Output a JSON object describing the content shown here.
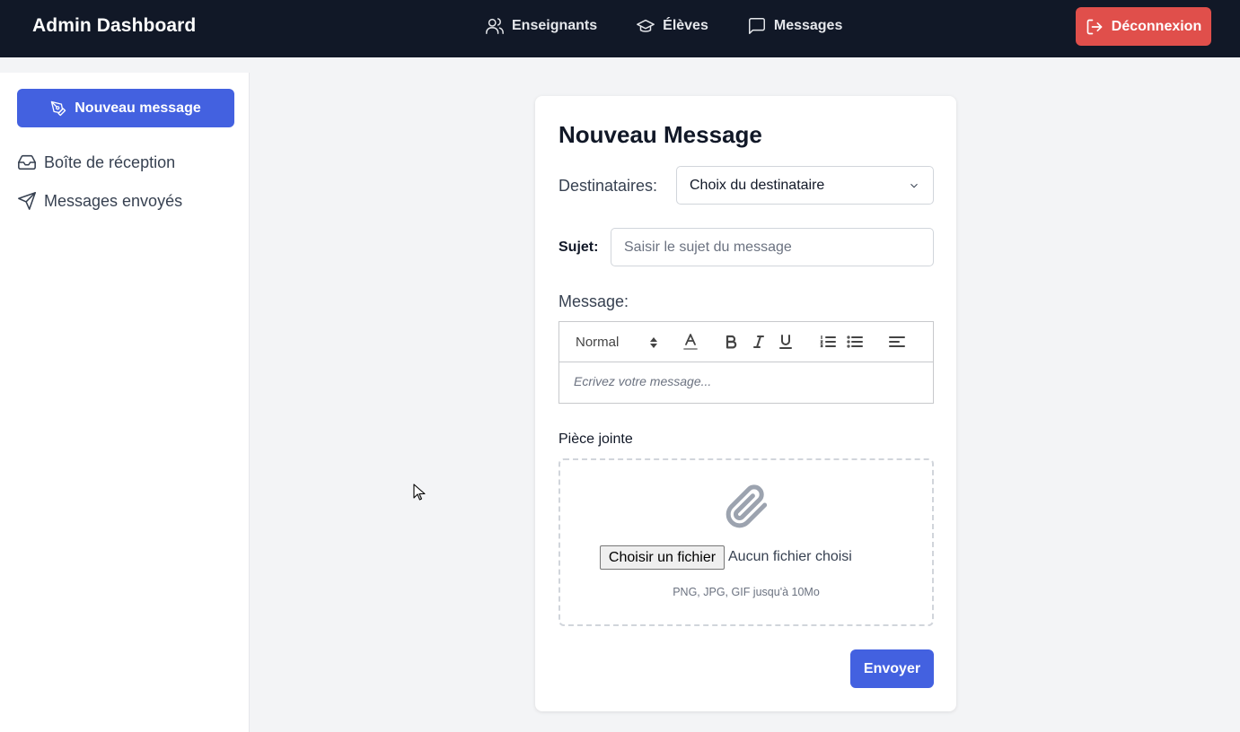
{
  "header": {
    "title": "Admin Dashboard",
    "nav": [
      {
        "label": "Enseignants",
        "icon": "users-icon"
      },
      {
        "label": "Élèves",
        "icon": "graduation-cap-icon"
      },
      {
        "label": "Messages",
        "icon": "message-square-icon"
      }
    ],
    "logout_label": "Déconnexion",
    "logout_color": "#e04f4b"
  },
  "sidebar": {
    "new_message_label": "Nouveau message",
    "items": [
      {
        "label": "Boîte de réception",
        "icon": "inbox-icon"
      },
      {
        "label": "Messages envoyés",
        "icon": "send-icon"
      }
    ],
    "accent": "#4361e0"
  },
  "form": {
    "title": "Nouveau Message",
    "recipients_label": "Destinataires:",
    "recipients_value": "Choix du destinataire",
    "subject_label": "Sujet:",
    "subject_placeholder": "Saisir le sujet du message",
    "message_label": "Message:",
    "editor": {
      "format_value": "Normal",
      "placeholder": "Ecrivez votre message..."
    },
    "attachment_label": "Pièce jointe",
    "file_button_label": "Choisir un fichier",
    "file_status": "Aucun fichier choisi",
    "file_hint": "PNG, JPG, GIF jusqu'à 10Mo",
    "send_label": "Envoyer"
  }
}
